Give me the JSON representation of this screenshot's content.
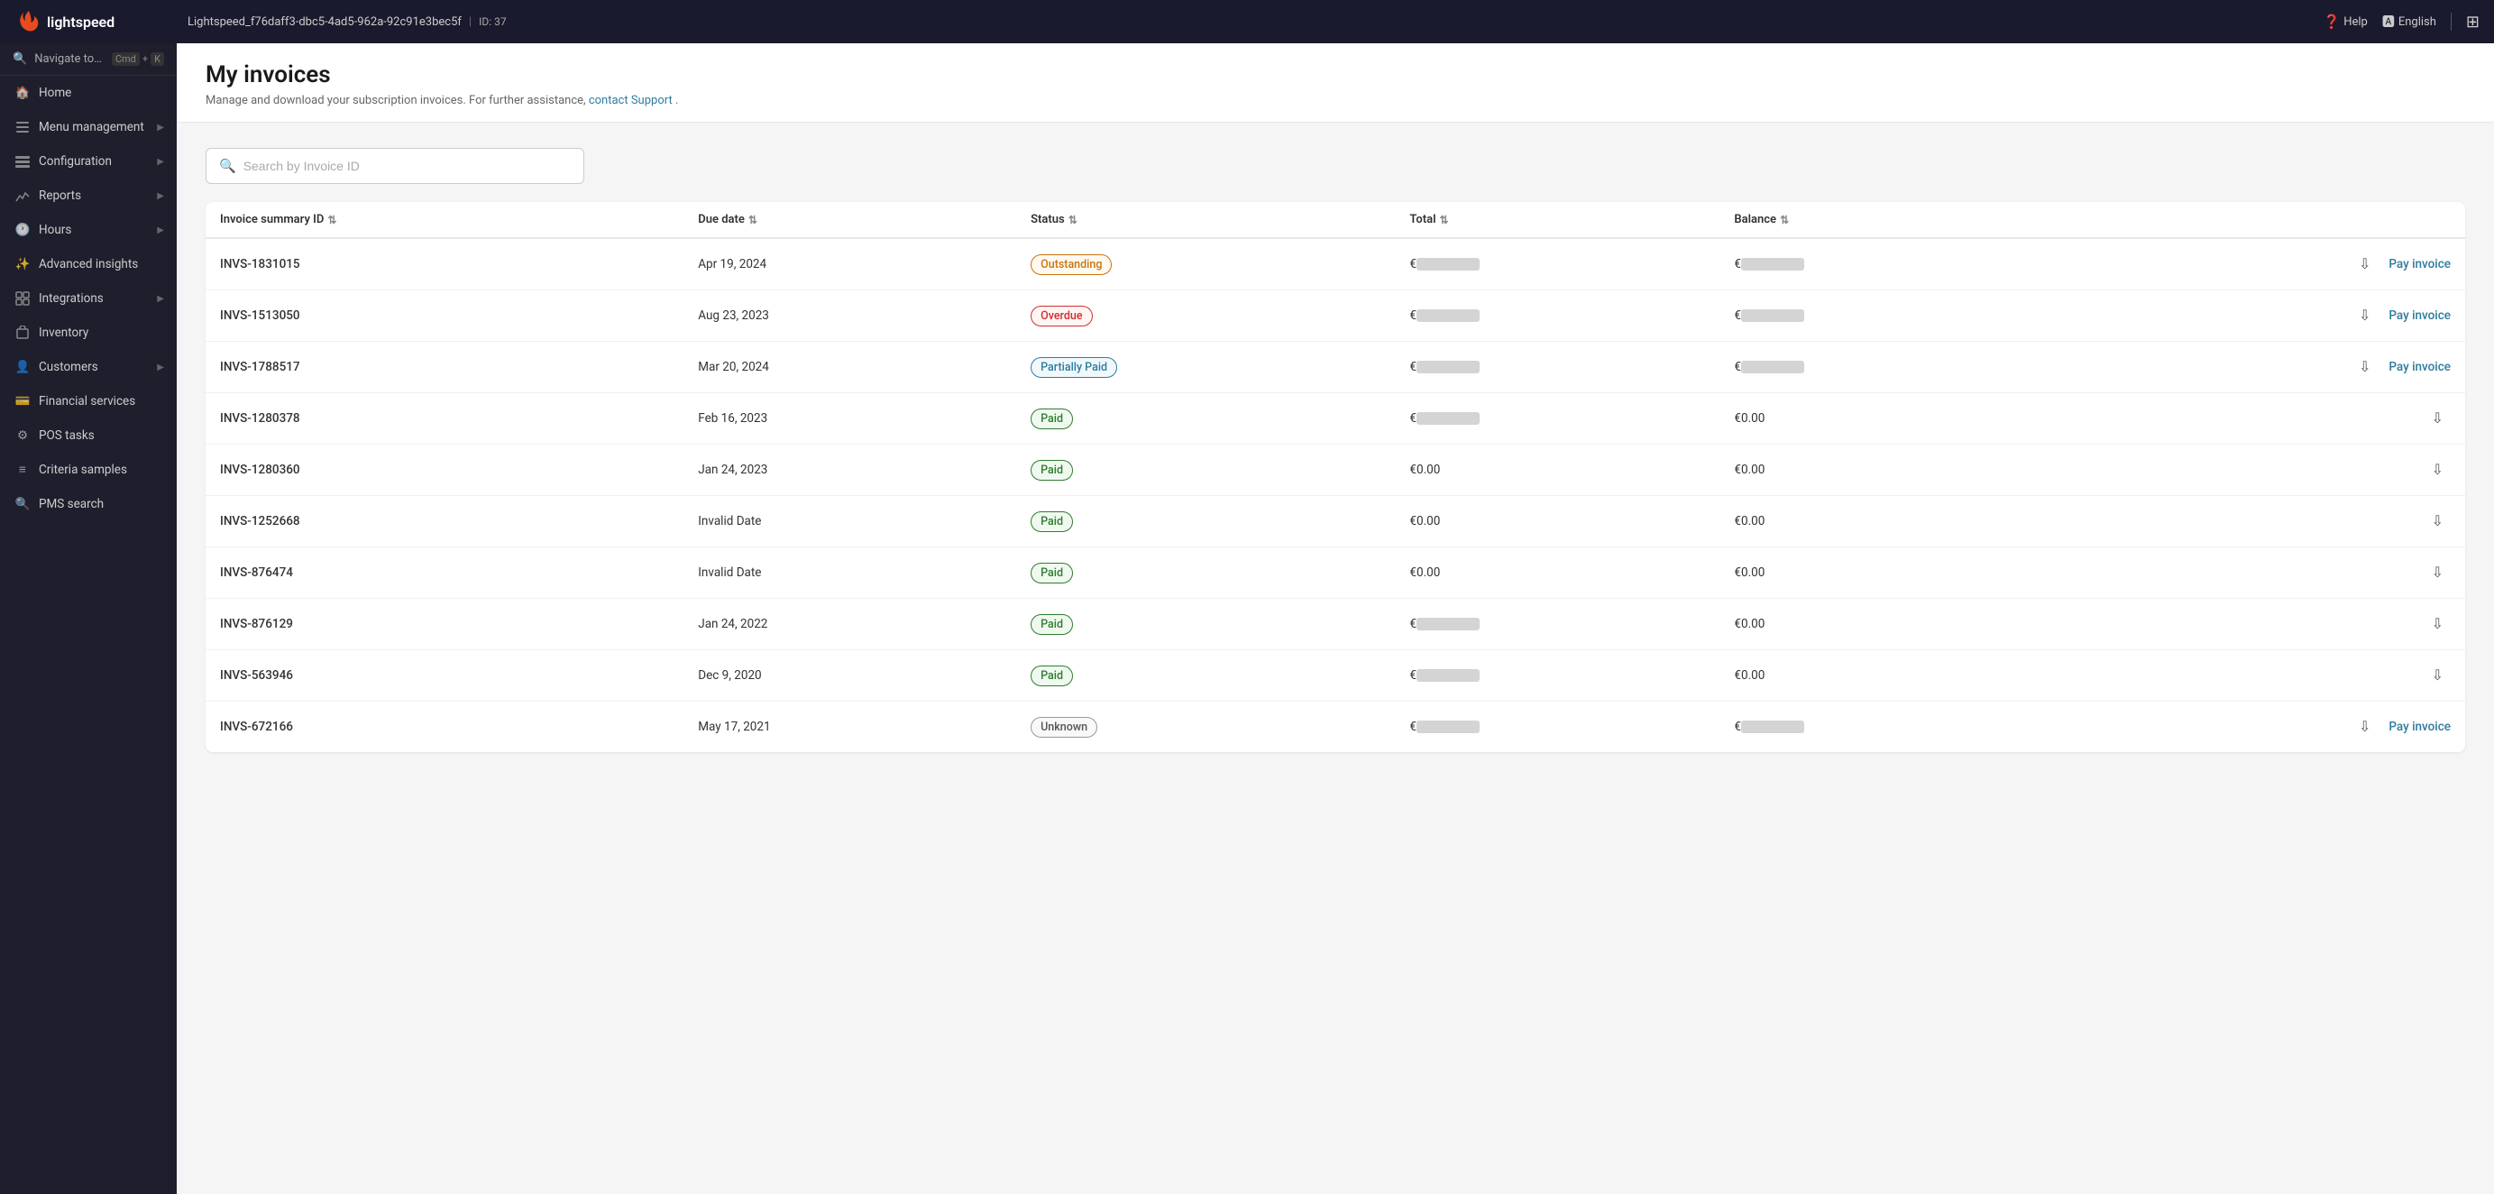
{
  "topbar": {
    "brand": "lightspeed",
    "breadcrumb": "Lightspeed_f76daff3-dbc5-4ad5-962a-92c91e3bec5f",
    "id_label": "ID: 37",
    "help_label": "Help",
    "lang_label": "English"
  },
  "sidebar": {
    "navigate_label": "Navigate to…",
    "kbd1": "Cmd",
    "kbd2": "K",
    "items": [
      {
        "id": "home",
        "label": "Home",
        "icon": "home",
        "arrow": false
      },
      {
        "id": "menu-management",
        "label": "Menu management",
        "icon": "menu",
        "arrow": true
      },
      {
        "id": "configuration",
        "label": "Configuration",
        "icon": "config",
        "arrow": true
      },
      {
        "id": "reports",
        "label": "Reports",
        "icon": "reports",
        "arrow": true
      },
      {
        "id": "hours",
        "label": "Hours",
        "icon": "clock",
        "arrow": true
      },
      {
        "id": "advanced-insights",
        "label": "Advanced insights",
        "icon": "insights",
        "arrow": false
      },
      {
        "id": "integrations",
        "label": "Integrations",
        "icon": "integrations",
        "arrow": true
      },
      {
        "id": "inventory",
        "label": "Inventory",
        "icon": "inventory",
        "arrow": false
      },
      {
        "id": "customers",
        "label": "Customers",
        "icon": "customers",
        "arrow": true
      },
      {
        "id": "financial-services",
        "label": "Financial services",
        "icon": "financial",
        "arrow": false
      },
      {
        "id": "pos-tasks",
        "label": "POS tasks",
        "icon": "pos",
        "arrow": false
      },
      {
        "id": "criteria-samples",
        "label": "Criteria samples",
        "icon": "criteria",
        "arrow": false
      },
      {
        "id": "pms-search",
        "label": "PMS search",
        "icon": "search",
        "arrow": false
      }
    ]
  },
  "page": {
    "title": "My invoices",
    "subtitle": "Manage and download your subscription invoices. For further assistance,",
    "support_link": "contact Support",
    "subtitle_end": "."
  },
  "search": {
    "placeholder": "Search by Invoice ID"
  },
  "table": {
    "columns": [
      {
        "key": "invoice_id",
        "label": "Invoice summary ID",
        "sortable": true
      },
      {
        "key": "due_date",
        "label": "Due date",
        "sortable": true
      },
      {
        "key": "status",
        "label": "Status",
        "sortable": true
      },
      {
        "key": "total",
        "label": "Total",
        "sortable": true
      },
      {
        "key": "balance",
        "label": "Balance",
        "sortable": true
      }
    ],
    "rows": [
      {
        "invoice_id": "INVS-1831015",
        "due_date": "Apr 19, 2024",
        "status": "Outstanding",
        "status_type": "outstanding",
        "total": "redacted",
        "balance": "redacted",
        "download": true,
        "pay": true
      },
      {
        "invoice_id": "INVS-1513050",
        "due_date": "Aug 23, 2023",
        "status": "Overdue",
        "status_type": "overdue",
        "total": "redacted",
        "balance": "redacted",
        "download": true,
        "pay": true
      },
      {
        "invoice_id": "INVS-1788517",
        "due_date": "Mar 20, 2024",
        "status": "Partially Paid",
        "status_type": "partially-paid",
        "total": "redacted",
        "balance": "redacted",
        "download": true,
        "pay": true
      },
      {
        "invoice_id": "INVS-1280378",
        "due_date": "Feb 16, 2023",
        "status": "Paid",
        "status_type": "paid",
        "total": "redacted",
        "balance": "€0.00",
        "download": true,
        "pay": false
      },
      {
        "invoice_id": "INVS-1280360",
        "due_date": "Jan 24, 2023",
        "status": "Paid",
        "status_type": "paid",
        "total": "€0.00",
        "balance": "€0.00",
        "download": true,
        "pay": false
      },
      {
        "invoice_id": "INVS-1252668",
        "due_date": "Invalid Date",
        "status": "Paid",
        "status_type": "paid",
        "total": "€0.00",
        "balance": "€0.00",
        "download": true,
        "pay": false
      },
      {
        "invoice_id": "INVS-876474",
        "due_date": "Invalid Date",
        "status": "Paid",
        "status_type": "paid",
        "total": "€0.00",
        "balance": "€0.00",
        "download": true,
        "pay": false
      },
      {
        "invoice_id": "INVS-876129",
        "due_date": "Jan 24, 2022",
        "status": "Paid",
        "status_type": "paid",
        "total": "redacted",
        "balance": "€0.00",
        "download": true,
        "pay": false
      },
      {
        "invoice_id": "INVS-563946",
        "due_date": "Dec 9, 2020",
        "status": "Paid",
        "status_type": "paid",
        "total": "redacted",
        "balance": "€0.00",
        "download": true,
        "pay": false
      },
      {
        "invoice_id": "INVS-672166",
        "due_date": "May 17, 2021",
        "status": "Unknown",
        "status_type": "unknown",
        "total": "redacted",
        "balance": "redacted",
        "download": true,
        "pay": true
      }
    ],
    "pay_label": "Pay invoice"
  }
}
